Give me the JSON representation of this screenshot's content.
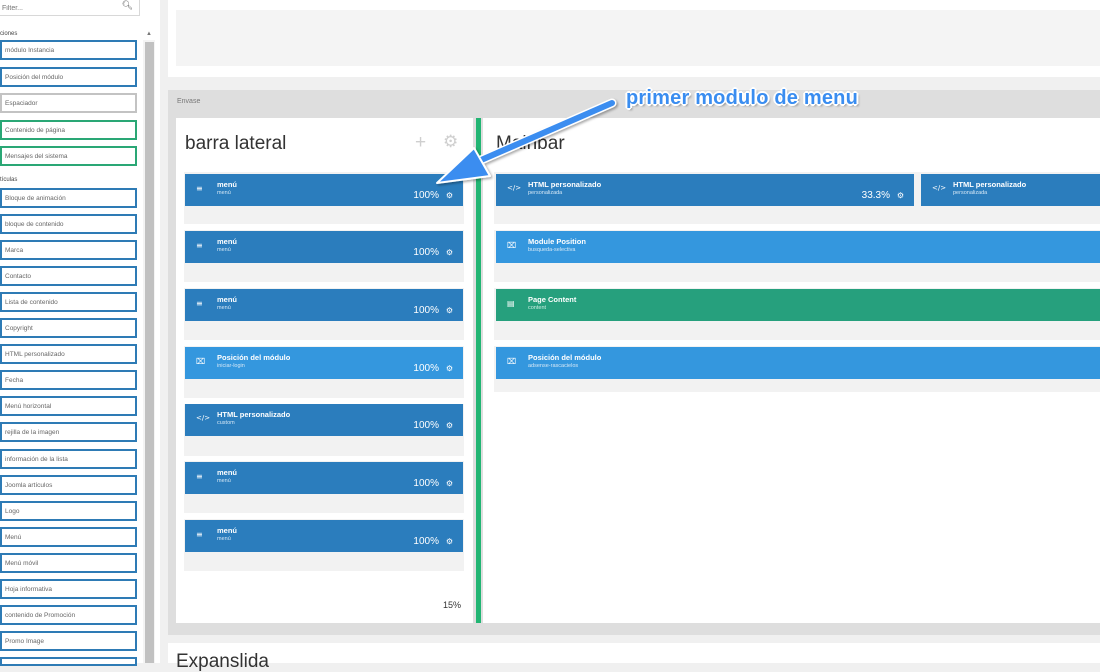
{
  "sidebar": {
    "filter_placeholder": "Filter...",
    "section_posiciones": "ciones",
    "section_particulas": "tículas",
    "items": [
      "módulo Instancia",
      "Posición del módulo",
      "Espaciador",
      "Contenido de página",
      "Mensajes del sistema",
      "Bloque de animación",
      "bloque de contenido",
      "Marca",
      "Contacto",
      "Lista de contenido",
      "Copyright",
      "HTML personalizado",
      "Fecha",
      "Menú horizontal",
      "rejilla de la imagen",
      "información de la lista",
      "Joomla artículos",
      "Logo",
      "Menú",
      "Menú móvil",
      "Hoja informativa",
      "contenido de Promoción",
      "Promo Image"
    ]
  },
  "container": {
    "label": "Envase",
    "left_column": {
      "title": "barra lateral",
      "add_icon": "+",
      "settings_icon": "gear-icon",
      "width": "15%",
      "modules": [
        {
          "title": "menú",
          "sub": "menú",
          "pct": "100%",
          "icon": "≡"
        },
        {
          "title": "menú",
          "sub": "menú",
          "pct": "100%",
          "icon": "≡"
        },
        {
          "title": "menú",
          "sub": "menú",
          "pct": "100%",
          "icon": "≡"
        },
        {
          "title": "Posición del módulo",
          "sub": "iniciar-login",
          "pct": "100%",
          "icon": "⌧"
        },
        {
          "title": "HTML personalizado",
          "sub": "custom",
          "pct": "100%",
          "icon": "</>"
        },
        {
          "title": "menú",
          "sub": "menú",
          "pct": "100%",
          "icon": "≡"
        },
        {
          "title": "menú",
          "sub": "menú",
          "pct": "100%",
          "icon": "≡"
        }
      ]
    },
    "right_column": {
      "title": "Mainbar",
      "modules": [
        {
          "title": "HTML personalizado",
          "sub": "personalizada",
          "pct": "33.3%",
          "icon": "</>"
        },
        {
          "title": "HTML personalizado",
          "sub": "personalizada",
          "icon": "</>"
        },
        {
          "title": "Module Position",
          "sub": "busqueda-selectiva",
          "icon": "⌧"
        },
        {
          "title": "Page Content",
          "sub": "content",
          "icon": "▤"
        },
        {
          "title": "Posición del módulo",
          "sub": "adsense-rascacielos",
          "icon": "⌧"
        }
      ]
    }
  },
  "bottom": {
    "title": "Expanslida"
  },
  "annotation": {
    "text": "primer modulo de menu",
    "color": "#3a8df0"
  },
  "colors": {
    "block_dark": "#2b7dbd",
    "block_light": "#3497de",
    "block_teal": "#26a07d",
    "divider": "#22b573"
  }
}
